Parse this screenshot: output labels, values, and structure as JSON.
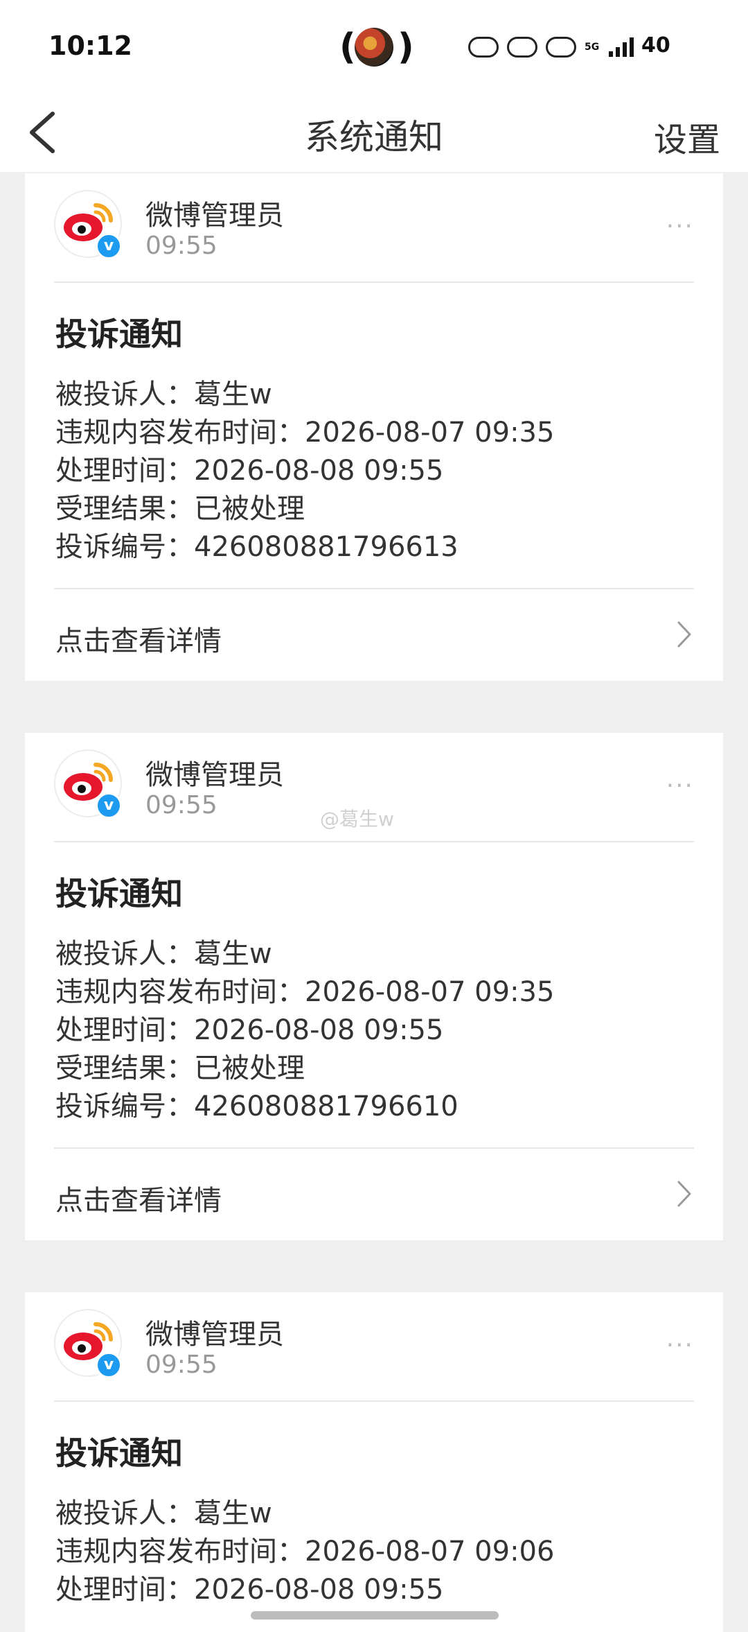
{
  "status_bar": {
    "time": "10:12",
    "paren_left": "(",
    "paren_right": ")",
    "network": "5G",
    "battery": "40"
  },
  "nav": {
    "title": "系统通知",
    "settings": "设置"
  },
  "watermark": "@葛生w",
  "cards": [
    {
      "sender": "微博管理员",
      "time": "09:55",
      "title": "投诉通知",
      "lines": [
        "被投诉人：葛生w",
        "违规内容发布时间：2026-08-07 09:35",
        "处理时间：2026-08-08 09:55",
        "受理结果：已被处理",
        "投诉编号：426080881796613"
      ],
      "detail": "点击查看详情"
    },
    {
      "sender": "微博管理员",
      "time": "09:55",
      "title": "投诉通知",
      "lines": [
        "被投诉人：葛生w",
        "违规内容发布时间：2026-08-07 09:35",
        "处理时间：2026-08-08 09:55",
        "受理结果：已被处理",
        "投诉编号：426080881796610"
      ],
      "detail": "点击查看详情"
    },
    {
      "sender": "微博管理员",
      "time": "09:55",
      "title": "投诉通知",
      "lines": [
        "被投诉人：葛生w",
        "违规内容发布时间：2026-08-07 09:06",
        "处理时间：2026-08-08 09:55"
      ]
    }
  ],
  "verified_badge": "v",
  "more_icon": "···",
  "colors": {
    "background": "#efefef",
    "card": "#ffffff",
    "verified": "#1d9bf0",
    "weibo_red": "#e6162d",
    "weibo_orange": "#f5a623"
  }
}
